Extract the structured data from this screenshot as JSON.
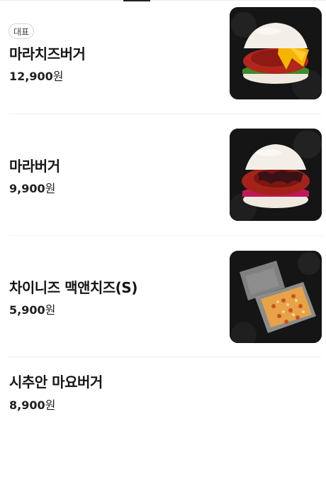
{
  "menu": {
    "items": [
      {
        "badge": "대표",
        "name": "마라치즈버거",
        "price_number": "12,900",
        "price_unit": "원",
        "image": "burger-cheese"
      },
      {
        "badge": "",
        "name": "마라버거",
        "price_number": "9,900",
        "price_unit": "원",
        "image": "burger-mala"
      },
      {
        "badge": "",
        "name": "차이니즈 맥앤치즈(S)",
        "price_number": "5,900",
        "price_unit": "원",
        "image": "mac-and-cheese-box"
      },
      {
        "badge": "",
        "name": "시추안 마요버거",
        "price_number": "8,900",
        "price_unit": "원",
        "image": ""
      }
    ]
  },
  "colors": {
    "background": "#ffffff",
    "text": "#151515",
    "divider": "#efefef",
    "thumbnail_bg": "#161616"
  }
}
